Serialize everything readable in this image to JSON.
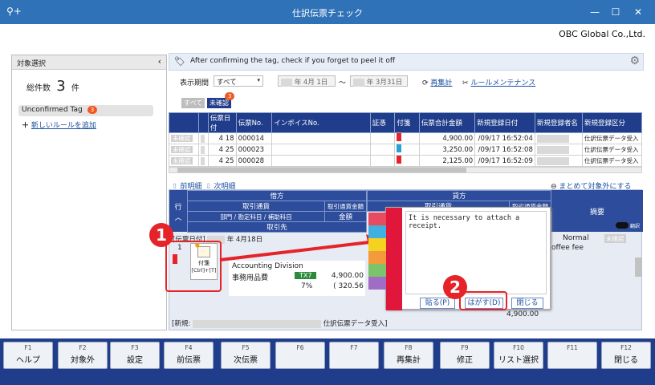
{
  "window": {
    "title": "仕訳伝票チェック",
    "company": "OBC Global Co.,Ltd."
  },
  "left": {
    "header": "対象選択",
    "total_label": "総件数",
    "total_count": "3",
    "total_unit": "件",
    "tag_label": "Unconfirmed Tag",
    "tag_badge": "3",
    "add_rule": "新しいルールを追加"
  },
  "banner": {
    "text": "After confirming the tag, check if you forget to peel it off"
  },
  "filter": {
    "period_label": "表示期間",
    "period_value": "すべて",
    "from_date": "年 4月 1日",
    "to_date": "年 3月31日",
    "tilde": "～",
    "recalc": "再集計",
    "rule_maint": "ルールメンテナンス",
    "chip_all": "すべて",
    "chip_unconfirmed": "未確認",
    "chip_badge": "3"
  },
  "grid": {
    "headers": [
      "伝票日付",
      "伝票No.",
      "インボイスNo.",
      "証憑",
      "付箋",
      "伝票合計金額",
      "新規登録日付",
      "新規登録者名",
      "新規登録区分"
    ],
    "status": "未確認",
    "rows": [
      {
        "day": "4 18",
        "no": "000014",
        "amount": "4,900.00",
        "reg": "/09/17 16:52:04",
        "kind": "仕訳伝票データ受入"
      },
      {
        "day": "4 25",
        "no": "000023",
        "amount": "3,250.00",
        "reg": "/09/17 16:52:08",
        "kind": "仕訳伝票データ受入"
      },
      {
        "day": "4 25",
        "no": "000028",
        "amount": "2,125.00",
        "reg": "/09/17 16:52:09",
        "kind": "仕訳伝票データ受入"
      }
    ]
  },
  "detail": {
    "prev": "前明細",
    "next": "次明細",
    "exclude": "まとめて対象外にする",
    "row_label": "行",
    "debit": "借方",
    "credit": "貸方",
    "currency": "取引通貨",
    "currency_amt": "取引通貨金額",
    "dept": "部門 / 勘定科目 / 補助科目",
    "amount": "金額",
    "partner": "取引先",
    "memo": "摘要",
    "toggle_label": "翻訳",
    "voucher_date_label": "[伝票日付]",
    "voucher_date": "年 4月18日",
    "line_no": "1",
    "sticky_label": "付箋",
    "sticky_shortcut": "[Ctrl]+[T]",
    "division": "Accounting Division",
    "account": "事務用品費",
    "tax_code": "TX7",
    "tax_rate": "7%",
    "debit_amount": "4,900.00",
    "tax_amount": "( 320.56",
    "memo_normal": "Normal",
    "memo_status": "未確認",
    "memo_text": "offee fee",
    "credit_amount": "4,900.00",
    "footer_prefix": "[新規:",
    "footer_suffix": "仕訳伝票データ受入]"
  },
  "popup": {
    "text": "It is necessary to attach a receipt.",
    "paste": "貼る(P)",
    "peel": "はがす(D)",
    "close": "閉じる"
  },
  "callouts": {
    "one": "1",
    "two": "2"
  },
  "fkeys": [
    {
      "key": "F1",
      "label": "ヘルプ"
    },
    {
      "key": "F2",
      "label": "対象外"
    },
    {
      "key": "F3",
      "label": "設定"
    },
    {
      "key": "F4",
      "label": "前伝票"
    },
    {
      "key": "F5",
      "label": "次伝票"
    },
    {
      "key": "F6",
      "label": ""
    },
    {
      "key": "F7",
      "label": ""
    },
    {
      "key": "F8",
      "label": "再集計"
    },
    {
      "key": "F9",
      "label": "修正"
    },
    {
      "key": "F10",
      "label": "リスト選択"
    },
    {
      "key": "F11",
      "label": ""
    },
    {
      "key": "F12",
      "label": "閉じる"
    }
  ],
  "colors": {
    "titlebar": "#2f72b7",
    "header": "#1f3d8a",
    "accent_red": "#e52329",
    "badge": "#f05a22"
  }
}
